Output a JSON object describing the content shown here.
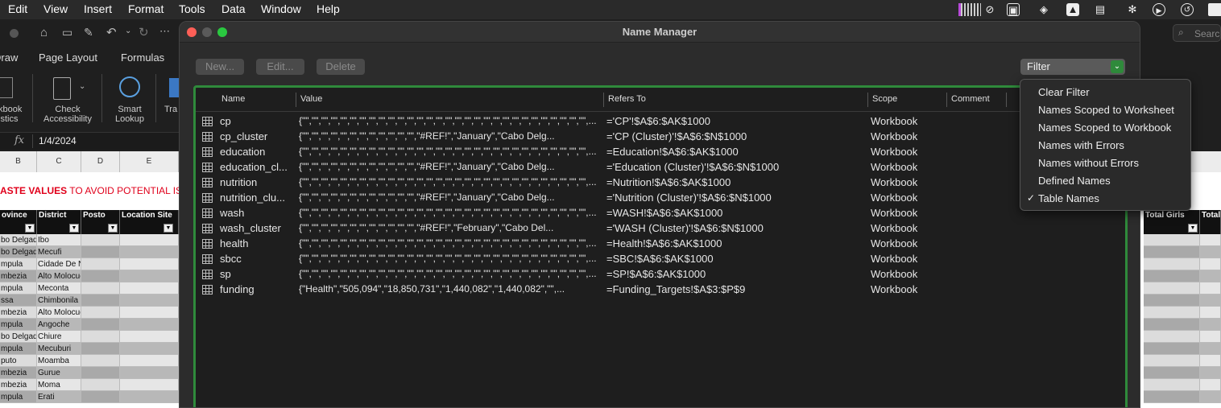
{
  "menubar": {
    "items": [
      "Edit",
      "View",
      "Insert",
      "Format",
      "Tools",
      "Data",
      "Window",
      "Help"
    ]
  },
  "ribbon": {
    "tabs": [
      "Draw",
      "Page Layout",
      "Formulas"
    ],
    "tab_draw_partial": "Draw",
    "workbook_stats_label": "kbook\nistics",
    "check_accessibility_label": "Check\nAccessibility",
    "smart_lookup_label": "Smart\nLookup",
    "tra_label": "Tra",
    "search_placeholder": "Search"
  },
  "formula_bar": {
    "fx": "fx",
    "value": "1/4/2024"
  },
  "sheet": {
    "columns": [
      "B",
      "C",
      "D",
      "E"
    ],
    "banner": {
      "bold": "ASTE VALUES",
      "rest": " TO AVOID POTENTIAL ISSU"
    },
    "headers": [
      "ovince",
      "District",
      "Posto",
      "Location Site"
    ],
    "rows": [
      [
        "bo Delgado",
        "Ibo"
      ],
      [
        "bo Delgado",
        "Mecufi"
      ],
      [
        "mpula",
        "Cidade De Nampula"
      ],
      [
        "mbezia",
        "Alto Molocue"
      ],
      [
        "mpula",
        "Meconta"
      ],
      [
        "ssa",
        "Chimbonila"
      ],
      [
        "mbezia",
        "Alto Molocue"
      ],
      [
        "mpula",
        "Angoche"
      ],
      [
        "bo Delgado",
        "Chiure"
      ],
      [
        "mpula",
        "Mecuburi"
      ],
      [
        "puto",
        "Moamba"
      ],
      [
        "mbezia",
        "Gurue"
      ],
      [
        "mbezia",
        "Moma"
      ],
      [
        "mpula",
        "Erati"
      ]
    ],
    "right_headers": [
      "Total Girls",
      "Total"
    ]
  },
  "dialog": {
    "title": "Name Manager",
    "buttons": {
      "new": "New...",
      "edit": "Edit...",
      "delete": "Delete"
    },
    "filter": {
      "label": "Filter",
      "chevron": "⌄"
    },
    "columns": [
      "Name",
      "Value",
      "Refers To",
      "Scope",
      "Comment"
    ],
    "rows": [
      {
        "name": "cp",
        "value": "{\"\",\"\",\"\",\"\",\"\",\"\",\"\",\"\",\"\",\"\",\"\",\"\",\"\",\"\",\"\",\"\",\"\",\"\",\"\",\"\",\"\",\"\",\"\",\"\",\"\",\"\",\"\",\"\",\"\",\"\",...",
        "refers": "='CP'!$A$6:$AK$1000",
        "scope": "Workbook"
      },
      {
        "name": "cp_cluster",
        "value": "{\"\",\"\",\"\",\"\",\"\",\"\",\"\",\"\",\"\",\"\",\"\",\"\",\"#REF!\",\"January\",\"Cabo Delg...",
        "refers": "='CP (Cluster)'!$A$6:$N$1000",
        "scope": "Workbook"
      },
      {
        "name": "education",
        "value": "{\"\",\"\",\"\",\"\",\"\",\"\",\"\",\"\",\"\",\"\",\"\",\"\",\"\",\"\",\"\",\"\",\"\",\"\",\"\",\"\",\"\",\"\",\"\",\"\",\"\",\"\",\"\",\"\",\"\",\"\",...",
        "refers": "=Education!$A$6:$AK$1000",
        "scope": "Workbook"
      },
      {
        "name": "education_cl...",
        "value": "{\"\",\"\",\"\",\"\",\"\",\"\",\"\",\"\",\"\",\"\",\"\",\"\",\"#REF!\",\"January\",\"Cabo Delg...",
        "refers": "='Education (Cluster)'!$A$6:$N$1000",
        "scope": "Workbook"
      },
      {
        "name": "nutrition",
        "value": "{\"\",\"\",\"\",\"\",\"\",\"\",\"\",\"\",\"\",\"\",\"\",\"\",\"\",\"\",\"\",\"\",\"\",\"\",\"\",\"\",\"\",\"\",\"\",\"\",\"\",\"\",\"\",\"\",\"\",\"\",...",
        "refers": "=Nutrition!$A$6:$AK$1000",
        "scope": "Workbook"
      },
      {
        "name": "nutrition_clu...",
        "value": "{\"\",\"\",\"\",\"\",\"\",\"\",\"\",\"\",\"\",\"\",\"\",\"\",\"#REF!\",\"January\",\"Cabo Delg...",
        "refers": "='Nutrition (Cluster)'!$A$6:$N$1000",
        "scope": "Workbook"
      },
      {
        "name": "wash",
        "value": "{\"\",\"\",\"\",\"\",\"\",\"\",\"\",\"\",\"\",\"\",\"\",\"\",\"\",\"\",\"\",\"\",\"\",\"\",\"\",\"\",\"\",\"\",\"\",\"\",\"\",\"\",\"\",\"\",\"\",\"\",...",
        "refers": "=WASH!$A$6:$AK$1000",
        "scope": "Workbook"
      },
      {
        "name": "wash_cluster",
        "value": "{\"\",\"\",\"\",\"\",\"\",\"\",\"\",\"\",\"\",\"\",\"\",\"\",\"#REF!\",\"February\",\"Cabo Del...",
        "refers": "='WASH (Cluster)'!$A$6:$N$1000",
        "scope": "Workbook"
      },
      {
        "name": "health",
        "value": "{\"\",\"\",\"\",\"\",\"\",\"\",\"\",\"\",\"\",\"\",\"\",\"\",\"\",\"\",\"\",\"\",\"\",\"\",\"\",\"\",\"\",\"\",\"\",\"\",\"\",\"\",\"\",\"\",\"\",\"\",...",
        "refers": "=Health!$A$6:$AK$1000",
        "scope": "Workbook"
      },
      {
        "name": "sbcc",
        "value": "{\"\",\"\",\"\",\"\",\"\",\"\",\"\",\"\",\"\",\"\",\"\",\"\",\"\",\"\",\"\",\"\",\"\",\"\",\"\",\"\",\"\",\"\",\"\",\"\",\"\",\"\",\"\",\"\",\"\",\"\",...",
        "refers": "=SBC!$A$6:$AK$1000",
        "scope": "Workbook"
      },
      {
        "name": "sp",
        "value": "{\"\",\"\",\"\",\"\",\"\",\"\",\"\",\"\",\"\",\"\",\"\",\"\",\"\",\"\",\"\",\"\",\"\",\"\",\"\",\"\",\"\",\"\",\"\",\"\",\"\",\"\",\"\",\"\",\"\",\"\",...",
        "refers": "=SP!$A$6:$AK$1000",
        "scope": "Workbook"
      },
      {
        "name": "funding",
        "value": "{\"Health\",\"505,094\",\"18,850,731\",\"1,440,082\",\"1,440,082\",\"\",...",
        "refers": "=Funding_Targets!$A$3:$P$9",
        "scope": "Workbook"
      }
    ]
  },
  "filter_menu": {
    "items": [
      {
        "label": "Clear Filter",
        "checked": false
      },
      {
        "label": "Names Scoped to Worksheet",
        "checked": false
      },
      {
        "label": "Names Scoped to Workbook",
        "checked": false
      },
      {
        "label": "Names with Errors",
        "checked": false
      },
      {
        "label": "Names without Errors",
        "checked": false
      },
      {
        "label": "Defined Names",
        "checked": false
      },
      {
        "label": "Table Names",
        "checked": true
      }
    ],
    "check_glyph": "✓"
  },
  "colors": {
    "accent_green": "#2f8a3b",
    "banner_red": "#e0001b"
  }
}
